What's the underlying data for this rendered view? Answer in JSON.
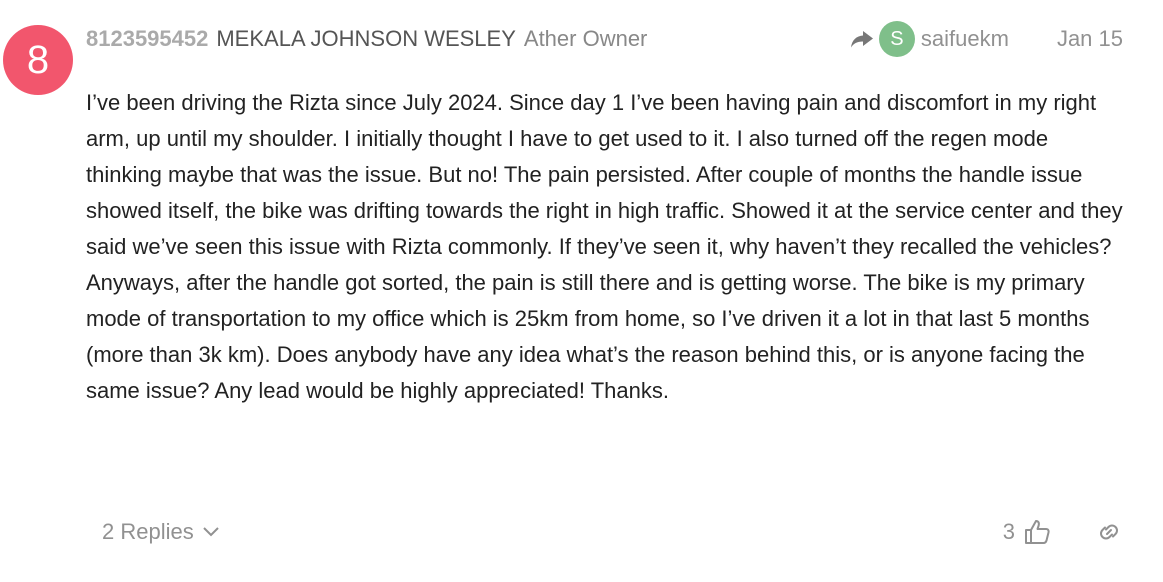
{
  "post": {
    "number": "8",
    "avatar_color": "#f2566d",
    "username": "8123595452",
    "full_name": "MEKALA JOHNSON WESLEY",
    "user_title": "Ather Owner",
    "reply_to": {
      "avatar_letter": "S",
      "avatar_color": "#7fbf8a",
      "username": "saifuekm"
    },
    "date": "Jan 15",
    "body": "I’ve been driving the Rizta since July 2024. Since day 1 I’ve been having pain and discomfort in my right arm, up until my shoulder. I initially thought I have to get used to it. I also turned off the regen mode thinking maybe that was the issue. But no! The pain persisted. After couple of months the handle issue showed itself, the bike was drifting towards the right in high traffic. Showed it at the service center and they said we’ve seen this issue with Rizta commonly. If they’ve seen it, why haven’t they recalled the vehicles? Anyways, after the handle got sorted, the pain is still there and is getting worse. The bike is my primary mode of transportation to my office which is 25km from home, so I’ve driven it a lot in that last 5 months (more than 3k km). Does anybody have any idea what’s the reason behind this, or is anyone facing the same issue? Any lead would be highly appreciated! Thanks.",
    "replies_label": "2 Replies",
    "like_count": "3"
  },
  "icons": {
    "reply": "reply-arrow-icon",
    "chevron": "chevron-down-icon",
    "like": "thumbs-up-icon",
    "link": "link-icon"
  },
  "colors": {
    "muted": "#919191",
    "text": "#222222"
  }
}
